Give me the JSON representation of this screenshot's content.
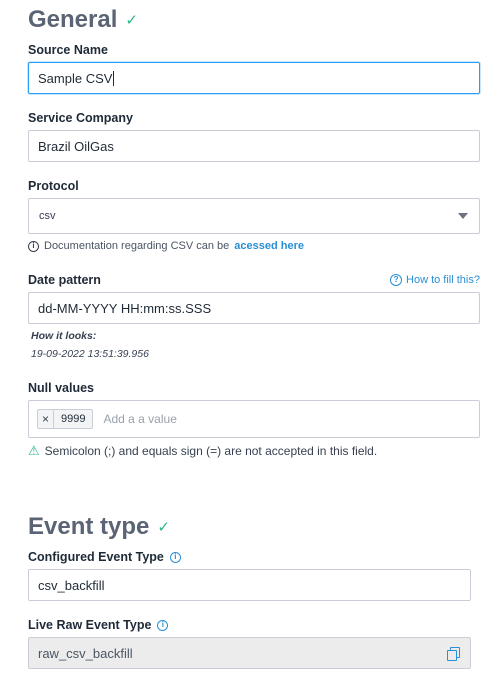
{
  "general": {
    "title": "General",
    "source_name": {
      "label": "Source Name",
      "value": "Sample CSV"
    },
    "service_company": {
      "label": "Service Company",
      "value": "Brazil OilGas"
    },
    "protocol": {
      "label": "Protocol",
      "selected": "csv",
      "helper_text": "Documentation regarding CSV can be",
      "helper_link": "acessed here"
    },
    "date_pattern": {
      "label": "Date pattern",
      "how_to_link": "How to fill this?",
      "value": "dd-MM-YYYY HH:mm:ss.SSS",
      "how_it_looks_label": "How it looks:",
      "how_it_looks_value": "19-09-2022 13:51:39.956"
    },
    "null_values": {
      "label": "Null values",
      "tags": [
        "9999"
      ],
      "placeholder": "Add a a value",
      "warning": "Semicolon (;) and equals sign (=) are not accepted in this field."
    }
  },
  "event_type": {
    "title": "Event type",
    "configured": {
      "label": "Configured Event Type",
      "value": "csv_backfill"
    },
    "live_raw": {
      "label": "Live Raw Event Type",
      "value": "raw_csv_backfill"
    }
  },
  "colors": {
    "accent": "#2a9df4",
    "link": "#2a8fd6",
    "success": "#2bb58a",
    "title_gray": "#5b6474"
  },
  "icons": {
    "check": "check-icon",
    "info": "info-icon",
    "help": "help-circle-icon",
    "remove": "close-icon",
    "warning": "warning-triangle-icon",
    "copy": "copy-icon",
    "dropdown": "chevron-down-icon"
  }
}
